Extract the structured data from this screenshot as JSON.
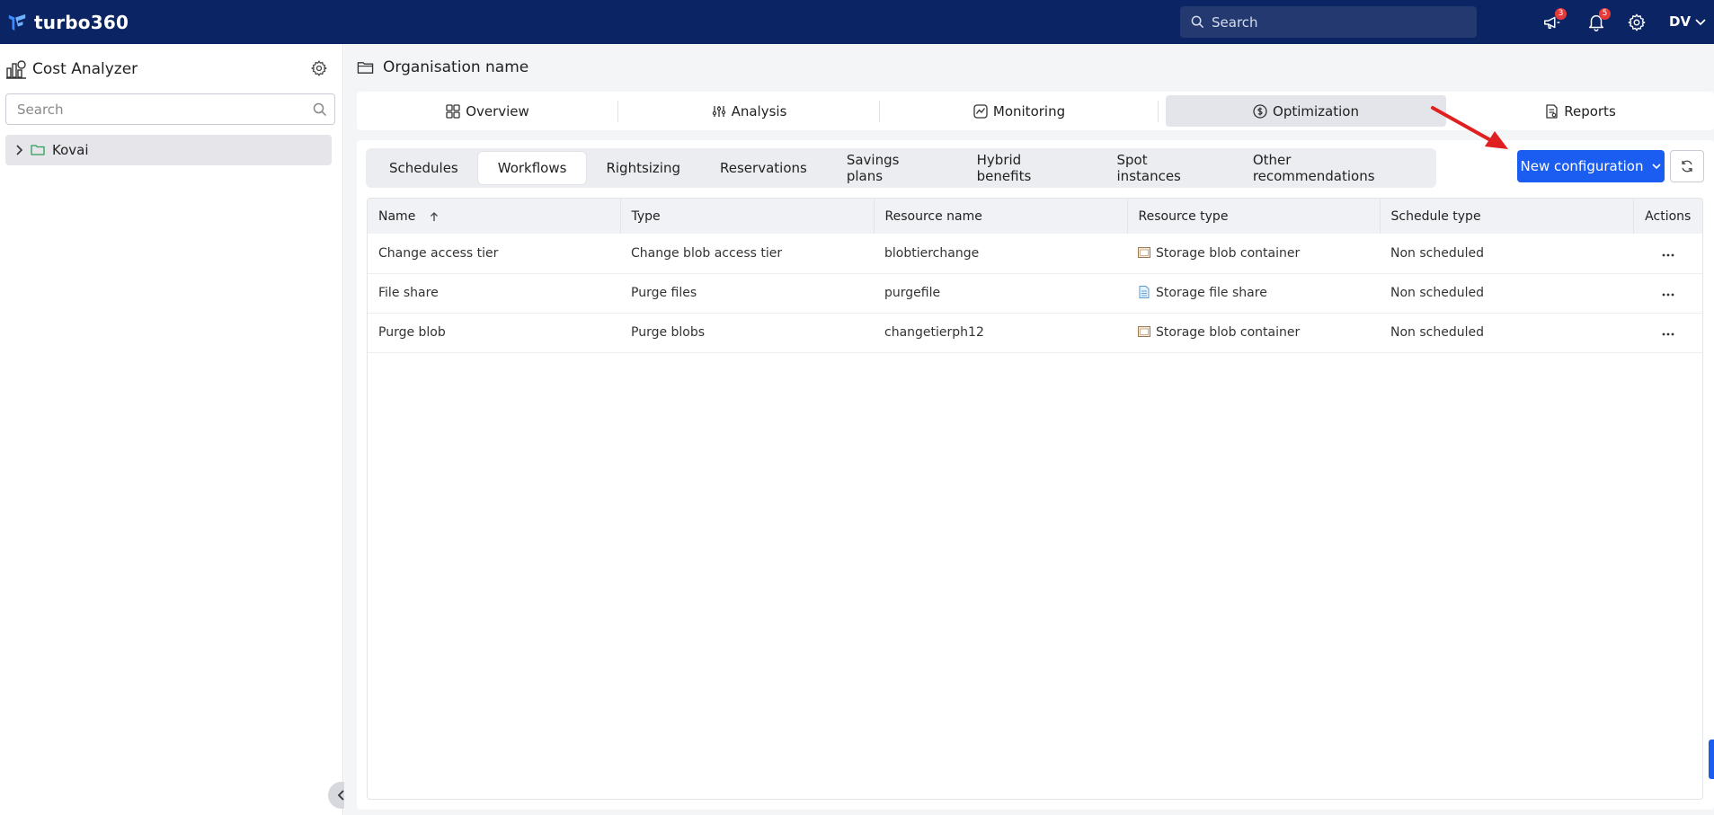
{
  "topbar": {
    "brand": "turbo360",
    "search_placeholder": "Search",
    "announcements_count": "3",
    "notifications_count": "5",
    "avatar_initials": "DV"
  },
  "sidebar": {
    "title": "Cost Analyzer",
    "search_placeholder": "Search",
    "tree": [
      {
        "label": "Kovai"
      }
    ]
  },
  "main": {
    "org_title": "Organisation name",
    "tabs": [
      {
        "label": "Overview",
        "icon": "grid-icon"
      },
      {
        "label": "Analysis",
        "icon": "analysis-icon"
      },
      {
        "label": "Monitoring",
        "icon": "monitoring-icon"
      },
      {
        "label": "Optimization",
        "icon": "dollar-circle-icon",
        "active": true
      },
      {
        "label": "Reports",
        "icon": "report-icon"
      }
    ],
    "sub_tabs": [
      {
        "label": "Schedules"
      },
      {
        "label": "Workflows",
        "active": true
      },
      {
        "label": "Rightsizing"
      },
      {
        "label": "Reservations"
      },
      {
        "label": "Savings plans"
      },
      {
        "label": "Hybrid benefits"
      },
      {
        "label": "Spot instances"
      },
      {
        "label": "Other recommendations"
      }
    ],
    "new_config_label": "New configuration",
    "table": {
      "columns": [
        "Name",
        "Type",
        "Resource name",
        "Resource type",
        "Schedule type",
        "Actions"
      ],
      "rows": [
        {
          "name": "Change access tier",
          "type": "Change blob access tier",
          "resource_name": "blobtierchange",
          "resource_type": "Storage blob container",
          "resource_icon": "blob-container-icon",
          "schedule_type": "Non scheduled"
        },
        {
          "name": "File share",
          "type": "Purge files",
          "resource_name": "purgefile",
          "resource_type": "Storage file share",
          "resource_icon": "file-share-icon",
          "schedule_type": "Non scheduled"
        },
        {
          "name": "Purge blob",
          "type": "Purge blobs",
          "resource_name": "changetierph12",
          "resource_type": "Storage blob container",
          "resource_icon": "blob-container-icon",
          "schedule_type": "Non scheduled"
        }
      ]
    }
  },
  "colors": {
    "topbar": "#0b2463",
    "primary": "#1a5df0",
    "annotation_arrow": "#e02020",
    "badge": "#e63b3b"
  }
}
